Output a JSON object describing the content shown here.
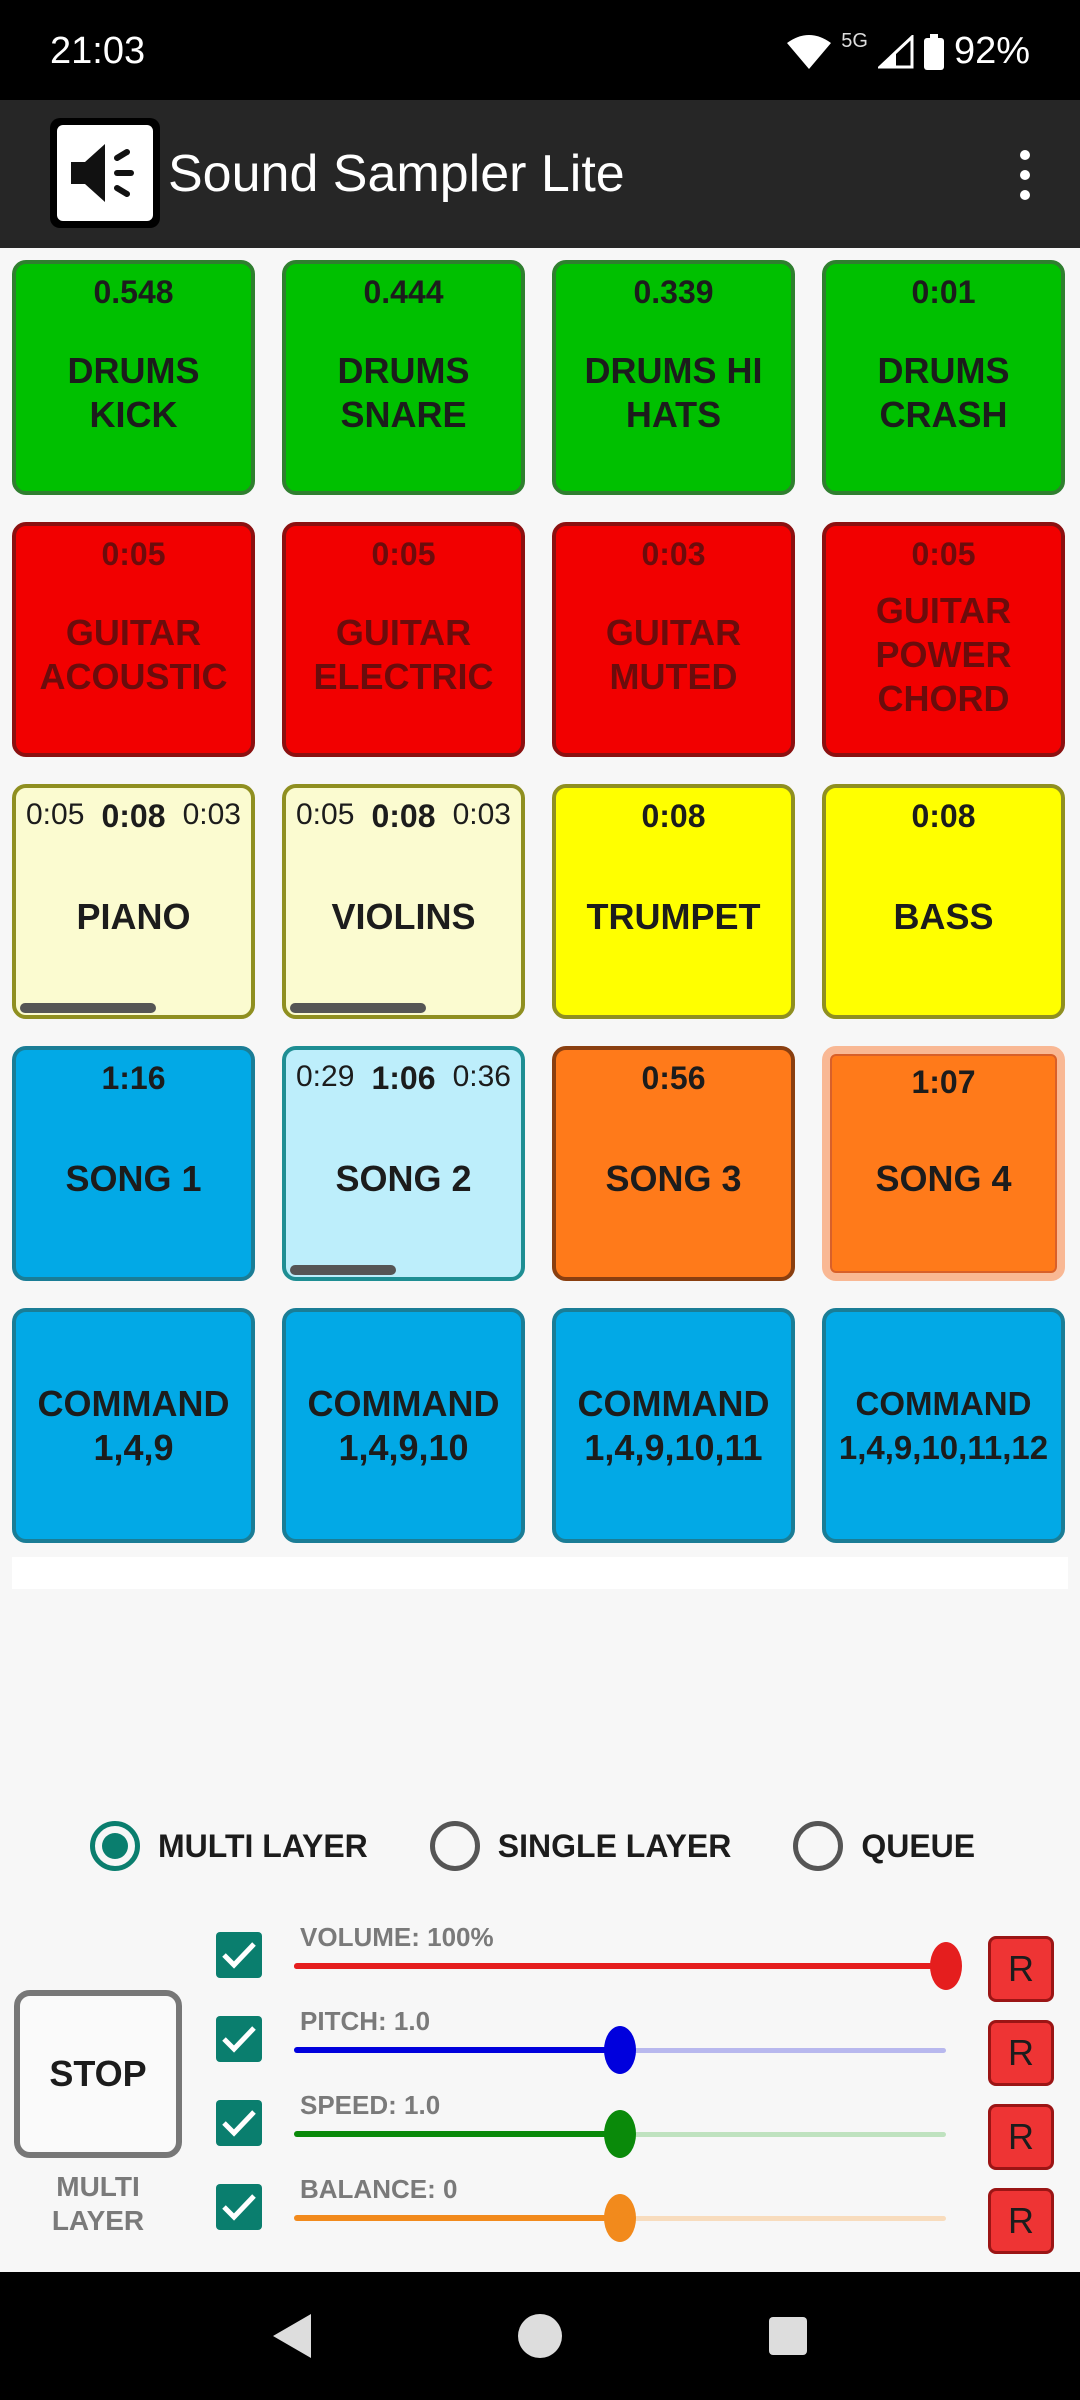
{
  "status_bar": {
    "time": "21:03",
    "network": "5G",
    "battery": "92%"
  },
  "app_bar": {
    "title": "Sound Sampler Lite",
    "logo_icon": "speaker-icon",
    "menu_icon": "more-vert-icon"
  },
  "pads": [
    {
      "label": "DRUMS KICK",
      "time": "0.548",
      "style": "green"
    },
    {
      "label": "DRUMS SNARE",
      "time": "0.444",
      "style": "green"
    },
    {
      "label": "DRUMS HI HATS",
      "time": "0.339",
      "style": "green"
    },
    {
      "label": "DRUMS CRASH",
      "time": "0:01",
      "style": "green"
    },
    {
      "label": "GUITAR ACOUSTIC",
      "time": "0:05",
      "style": "red"
    },
    {
      "label": "GUITAR ELECTRIC",
      "time": "0:05",
      "style": "red"
    },
    {
      "label": "GUITAR MUTED",
      "time": "0:03",
      "style": "red"
    },
    {
      "label": "GUITAR POWER CHORD",
      "time": "0:05",
      "style": "red"
    },
    {
      "label": "PIANO",
      "time_elapsed": "0:05",
      "time_total": "0:08",
      "time_remaining": "0:03",
      "progress": 0.58,
      "style": "paleyellow"
    },
    {
      "label": "VIOLINS",
      "time_elapsed": "0:05",
      "time_total": "0:08",
      "time_remaining": "0:03",
      "progress": 0.58,
      "style": "paleyellow"
    },
    {
      "label": "TRUMPET",
      "time": "0:08",
      "style": "yellow"
    },
    {
      "label": "BASS",
      "time": "0:08",
      "style": "yellow"
    },
    {
      "label": "SONG 1",
      "time": "1:16",
      "style": "blue"
    },
    {
      "label": "SONG 2",
      "time_elapsed": "0:29",
      "time_total": "1:06",
      "time_remaining": "0:36",
      "progress": 0.45,
      "style": "paleblue"
    },
    {
      "label": "SONG 3",
      "time": "0:56",
      "style": "orange"
    },
    {
      "label": "SONG 4",
      "time": "1:07",
      "style": "orange-sel"
    },
    {
      "label": "COMMAND 1,4,9",
      "style": "blue"
    },
    {
      "label": "COMMAND 1,4,9,10",
      "style": "blue"
    },
    {
      "label": "COMMAND 1,4,9,10,11",
      "style": "blue"
    },
    {
      "label": "COMMAND 1,4,9,10,11,12",
      "style": "blue"
    }
  ],
  "modes": [
    {
      "label": "MULTI LAYER",
      "checked": true
    },
    {
      "label": "SINGLE LAYER",
      "checked": false
    },
    {
      "label": "QUEUE",
      "checked": false
    }
  ],
  "stop": {
    "label": "STOP",
    "mode_line1": "MULTI",
    "mode_line2": "LAYER"
  },
  "controls": [
    {
      "label": "VOLUME: 100%",
      "value": 1.0,
      "color": "#e51e1e",
      "track": "#e51e1e",
      "reset": "R"
    },
    {
      "label": "PITCH: 1.0",
      "value": 0.5,
      "color": "#0000dd",
      "track": "#b8b8ee",
      "reset": "R"
    },
    {
      "label": "SPEED: 1.0",
      "value": 0.5,
      "color": "#0a8a0a",
      "track": "#bfe2bf",
      "reset": "R"
    },
    {
      "label": "BALANCE: 0",
      "value": 0.5,
      "color": "#f28a1c",
      "track": "#f8dcbd",
      "reset": "R"
    }
  ],
  "nav": {
    "back_icon": "back-icon",
    "home_icon": "home-icon",
    "recent_icon": "recents-icon"
  }
}
